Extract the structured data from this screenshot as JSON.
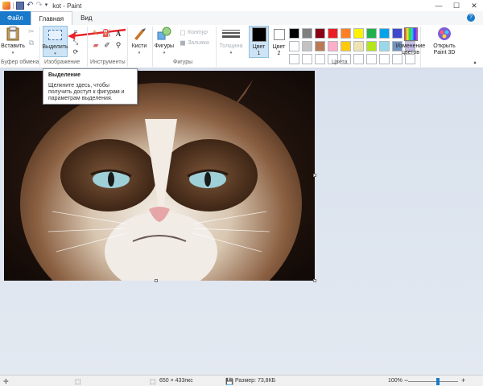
{
  "titlebar": {
    "title": "kot - Paint"
  },
  "tabs": {
    "file": "Файл",
    "home": "Главная",
    "view": "Вид"
  },
  "ribbon": {
    "paste": "Вставить",
    "select": "Выделить",
    "brushes": "Кисти",
    "shapes": "Фигуры",
    "outline": "Контур",
    "fill": "Заливка",
    "thickness": "Толщина",
    "color1": [
      "Цвет",
      "1"
    ],
    "color2": [
      "Цвет",
      "2"
    ],
    "edit_colors": [
      "Изменение",
      "цветов"
    ],
    "open_paint3d": [
      "Открыть",
      "Paint 3D"
    ],
    "text_tool": "A",
    "groups": {
      "clipboard": "Буфер обмена",
      "image": "Изображение",
      "tools": "Инструменты",
      "shapes": "Фигуры",
      "colors": "Цвета"
    },
    "palette": [
      "#000000",
      "#7f7f7f",
      "#880015",
      "#ed1c24",
      "#ff7f27",
      "#fff200",
      "#22b14c",
      "#00a2e8",
      "#3f48cc",
      "#a349a4",
      "#ffffff",
      "#c3c3c3",
      "#b97a57",
      "#ffaec9",
      "#ffc90e",
      "#efe4b0",
      "#b5e61d",
      "#99d9ea",
      "#7092be",
      "#c8bfe7",
      "#ffffff",
      "#ffffff",
      "#ffffff",
      "#ffffff",
      "#ffffff",
      "#ffffff",
      "#ffffff",
      "#ffffff",
      "#ffffff",
      "#ffffff"
    ]
  },
  "tooltip": {
    "title": "Выделение",
    "lines": [
      "Щелкните здесь, чтобы",
      "получить доступ к фигурам и",
      "параметрам выделения."
    ]
  },
  "status": {
    "dimensions": "650 × 433пкс",
    "size": "Размер: 73,8КБ",
    "zoom": "100%",
    "zoom_fraction": 0.6
  }
}
